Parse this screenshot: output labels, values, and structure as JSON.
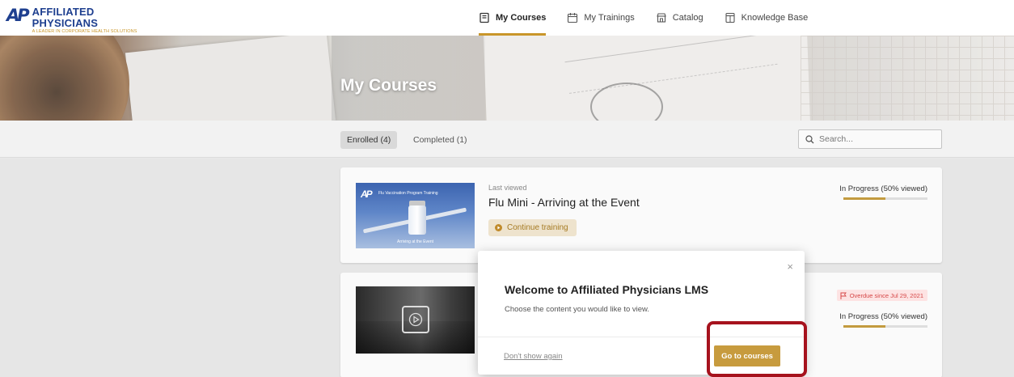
{
  "header": {
    "logo_mark": "AP",
    "logo_name": "AFFILIATED PHYSICIANS",
    "logo_tagline": "A LEADER IN CORPORATE HEALTH SOLUTIONS",
    "nav": [
      {
        "label": "My Courses",
        "icon": "book-icon",
        "active": true
      },
      {
        "label": "My Trainings",
        "icon": "calendar-icon"
      },
      {
        "label": "Catalog",
        "icon": "store-icon"
      },
      {
        "label": "Knowledge Base",
        "icon": "book-open-icon"
      }
    ]
  },
  "hero": {
    "title": "My Courses"
  },
  "tabs": [
    {
      "label": "Enrolled (4)",
      "active": true
    },
    {
      "label": "Completed (1)"
    }
  ],
  "search": {
    "placeholder": "Search..."
  },
  "courses": [
    {
      "thumbnail_title": "Flu Vaccination Program Training",
      "thumbnail_caption": "Arriving at the Event",
      "last_viewed": "Last viewed",
      "title": "Flu Mini - Arriving at the Event",
      "action": "Continue training",
      "status": "In Progress (50% viewed)",
      "progress": 0.5
    },
    {
      "overdue": "Overdue since Jul 29, 2021",
      "status": "In Progress (50% viewed)",
      "progress": 0.5
    }
  ],
  "modal": {
    "close": "×",
    "title": "Welcome to Affiliated Physicians LMS",
    "text": "Choose the content you would like to view.",
    "dont_show": "Don't show again",
    "go_button": "Go to courses"
  },
  "colors": {
    "accent": "#c79b3e",
    "brand": "#1e3f8f",
    "highlight": "#a6121d",
    "overdue": "#d64848"
  }
}
